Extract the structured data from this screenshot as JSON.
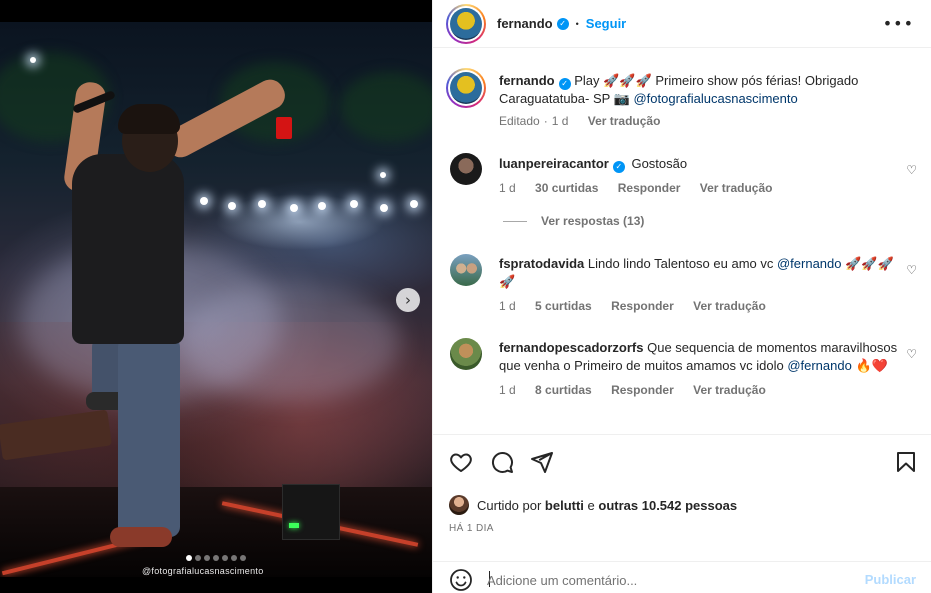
{
  "media": {
    "watermark": "@fotografialucasnascimento",
    "carousel": {
      "count": 7,
      "active_index": 0
    }
  },
  "post": {
    "author": "fernando",
    "follow_label": "Seguir",
    "more_label": "•••",
    "separator": "•"
  },
  "caption": {
    "username": "fernando",
    "text_before": "Play 🚀🚀🚀 Primeiro show pós férias! Obrigado Caraguatatuba- SP 📷 ",
    "mention": "@fotografialucasnascimento",
    "meta_edited": "Editado",
    "meta_time": "1 d",
    "translate": "Ver tradução"
  },
  "comments": [
    {
      "username": "luanpereiracantor",
      "verified": true,
      "text": "Gostosão",
      "time": "1 d",
      "likes": "30 curtidas",
      "reply": "Responder",
      "translate": "Ver tradução",
      "view_replies": "Ver respostas (13)"
    },
    {
      "username": "fspratodavida",
      "text_before": "Lindo lindo Talentoso eu amo vc ",
      "mention": "@fernando",
      "text_after": " 🚀🚀🚀🚀",
      "time": "1 d",
      "likes": "5 curtidas",
      "reply": "Responder",
      "translate": "Ver tradução"
    },
    {
      "username": "fernandopescadorzorfs",
      "text_before": "Que sequencia de momentos maravilhosos que venha o Primeiro de muitos amamos vc idolo ",
      "mention": "@fernando",
      "text_after": " 🔥❤️",
      "time": "1 d",
      "likes": "8 curtidas",
      "reply": "Responder",
      "translate": "Ver tradução"
    }
  ],
  "actions": {
    "liked_prefix": "Curtido por ",
    "liked_user": "belutti",
    "liked_mid": " e ",
    "liked_others": "outras 10.542 pessoas",
    "time_ago": "HÁ 1 DIA"
  },
  "comment_box": {
    "placeholder": "Adicione um comentário...",
    "publish": "Publicar"
  },
  "colors": {
    "accent": "#0095f6",
    "link": "#00376b",
    "publish_disabled": "#b3dbff"
  },
  "icons": [
    "chevron-right-icon",
    "verified-icon",
    "more-icon",
    "heart-icon",
    "comment-icon",
    "share-icon",
    "bookmark-icon",
    "emoji-icon"
  ]
}
